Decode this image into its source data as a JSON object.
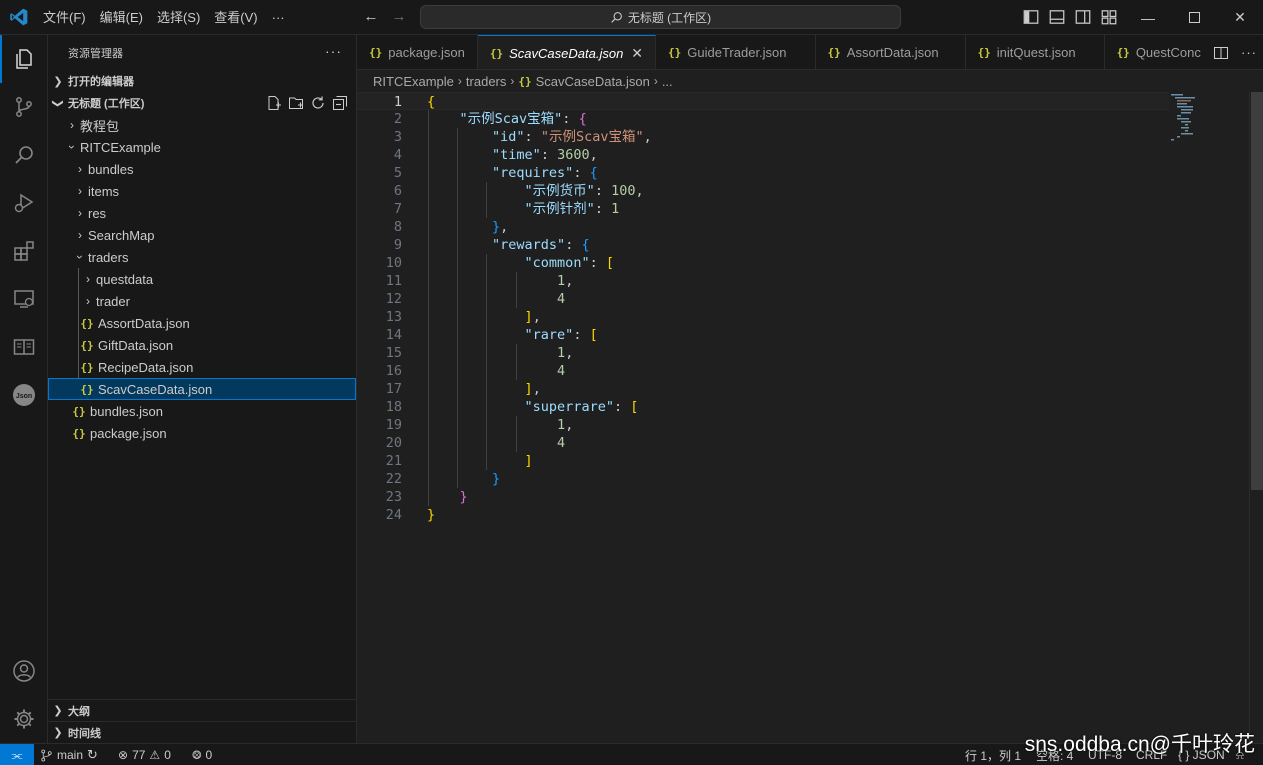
{
  "titlebar": {
    "menu": [
      "文件(F)",
      "编辑(E)",
      "选择(S)",
      "查看(V)",
      "···"
    ],
    "search_text": "无标题 (工作区)"
  },
  "activity": [
    "explorer-icon",
    "source-control-icon",
    "search-icon",
    "run-debug-icon",
    "extensions-icon",
    "remote-explorer-icon",
    "book-icon",
    "json-icon",
    "account-icon",
    "settings-gear-icon"
  ],
  "sidebar": {
    "title": "资源管理器",
    "more": "···",
    "open_editors": "打开的编辑器",
    "workspace": "无标题 (工作区)",
    "tree": [
      {
        "label": "教程包",
        "depth": 1,
        "type": "folder",
        "open": false
      },
      {
        "label": "RITCExample",
        "depth": 1,
        "type": "folder",
        "open": true
      },
      {
        "label": "bundles",
        "depth": 2,
        "type": "folder",
        "open": false
      },
      {
        "label": "items",
        "depth": 2,
        "type": "folder",
        "open": false
      },
      {
        "label": "res",
        "depth": 2,
        "type": "folder",
        "open": false
      },
      {
        "label": "SearchMap",
        "depth": 2,
        "type": "folder",
        "open": false
      },
      {
        "label": "traders",
        "depth": 2,
        "type": "folder",
        "open": true
      },
      {
        "label": "questdata",
        "depth": 3,
        "type": "folder",
        "open": false
      },
      {
        "label": "trader",
        "depth": 3,
        "type": "folder",
        "open": false
      },
      {
        "label": "AssortData.json",
        "depth": 3,
        "type": "json"
      },
      {
        "label": "GiftData.json",
        "depth": 3,
        "type": "json"
      },
      {
        "label": "RecipeData.json",
        "depth": 3,
        "type": "json"
      },
      {
        "label": "ScavCaseData.json",
        "depth": 3,
        "type": "json",
        "selected": true
      },
      {
        "label": "bundles.json",
        "depth": 2,
        "type": "json"
      },
      {
        "label": "package.json",
        "depth": 2,
        "type": "json"
      }
    ],
    "outline": "大纲",
    "timeline": "时间线"
  },
  "tabs": [
    {
      "label": "package.json",
      "active": false
    },
    {
      "label": "ScavCaseData.json",
      "active": true
    },
    {
      "label": "GuideTrader.json",
      "active": false
    },
    {
      "label": "AssortData.json",
      "active": false
    },
    {
      "label": "initQuest.json",
      "active": false
    },
    {
      "label": "QuestConc",
      "active": false
    }
  ],
  "breadcrumbs": [
    "RITCExample",
    "traders",
    "ScavCaseData.json",
    "..."
  ],
  "code": {
    "current_line": 1,
    "lines": [
      [
        [
          "{",
          "b1"
        ]
      ],
      [
        [
          "    ",
          "p"
        ],
        [
          "\"示例Scav宝箱\"",
          "k"
        ],
        [
          ": ",
          "p"
        ],
        [
          "{",
          "b2"
        ]
      ],
      [
        [
          "        ",
          "p"
        ],
        [
          "\"id\"",
          "k"
        ],
        [
          ": ",
          "p"
        ],
        [
          "\"示例Scav宝箱\"",
          "s"
        ],
        [
          ",",
          "p"
        ]
      ],
      [
        [
          "        ",
          "p"
        ],
        [
          "\"time\"",
          "k"
        ],
        [
          ": ",
          "p"
        ],
        [
          "3600",
          "n"
        ],
        [
          ",",
          "p"
        ]
      ],
      [
        [
          "        ",
          "p"
        ],
        [
          "\"requires\"",
          "k"
        ],
        [
          ": ",
          "p"
        ],
        [
          "{",
          "b3"
        ]
      ],
      [
        [
          "            ",
          "p"
        ],
        [
          "\"示例货币\"",
          "k"
        ],
        [
          ": ",
          "p"
        ],
        [
          "100",
          "n"
        ],
        [
          ",",
          "p"
        ]
      ],
      [
        [
          "            ",
          "p"
        ],
        [
          "\"示例针剂\"",
          "k"
        ],
        [
          ": ",
          "p"
        ],
        [
          "1",
          "n"
        ]
      ],
      [
        [
          "        ",
          "p"
        ],
        [
          "}",
          "b3"
        ],
        [
          ",",
          "p"
        ]
      ],
      [
        [
          "        ",
          "p"
        ],
        [
          "\"rewards\"",
          "k"
        ],
        [
          ": ",
          "p"
        ],
        [
          "{",
          "b3"
        ]
      ],
      [
        [
          "            ",
          "p"
        ],
        [
          "\"common\"",
          "k"
        ],
        [
          ": ",
          "p"
        ],
        [
          "[",
          "b1"
        ]
      ],
      [
        [
          "                ",
          "p"
        ],
        [
          "1",
          "n"
        ],
        [
          ",",
          "p"
        ]
      ],
      [
        [
          "                ",
          "p"
        ],
        [
          "4",
          "n"
        ]
      ],
      [
        [
          "            ",
          "p"
        ],
        [
          "]",
          "b1"
        ],
        [
          ",",
          "p"
        ]
      ],
      [
        [
          "            ",
          "p"
        ],
        [
          "\"rare\"",
          "k"
        ],
        [
          ": ",
          "p"
        ],
        [
          "[",
          "b1"
        ]
      ],
      [
        [
          "                ",
          "p"
        ],
        [
          "1",
          "n"
        ],
        [
          ",",
          "p"
        ]
      ],
      [
        [
          "                ",
          "p"
        ],
        [
          "4",
          "n"
        ]
      ],
      [
        [
          "            ",
          "p"
        ],
        [
          "]",
          "b1"
        ],
        [
          ",",
          "p"
        ]
      ],
      [
        [
          "            ",
          "p"
        ],
        [
          "\"superrare\"",
          "k"
        ],
        [
          ": ",
          "p"
        ],
        [
          "[",
          "b1"
        ]
      ],
      [
        [
          "                ",
          "p"
        ],
        [
          "1",
          "n"
        ],
        [
          ",",
          "p"
        ]
      ],
      [
        [
          "                ",
          "p"
        ],
        [
          "4",
          "n"
        ]
      ],
      [
        [
          "            ",
          "p"
        ],
        [
          "]",
          "b1"
        ]
      ],
      [
        [
          "        ",
          "p"
        ],
        [
          "}",
          "b3"
        ]
      ],
      [
        [
          "    ",
          "p"
        ],
        [
          "}",
          "b2"
        ]
      ],
      [
        [
          "}",
          "b1"
        ]
      ]
    ]
  },
  "statusbar": {
    "branch": "main",
    "errors": "77",
    "warnings": "0",
    "ports": "0",
    "position": "行 1，列 1",
    "spaces": "空格: 4",
    "encoding": "UTF-8",
    "eol": "CRLF",
    "language": "{ } JSON"
  },
  "watermark": "sns.oddba.cn@千叶玲花",
  "colors": {
    "accent": "#0078d4",
    "json_icon": "#cbcb41"
  }
}
